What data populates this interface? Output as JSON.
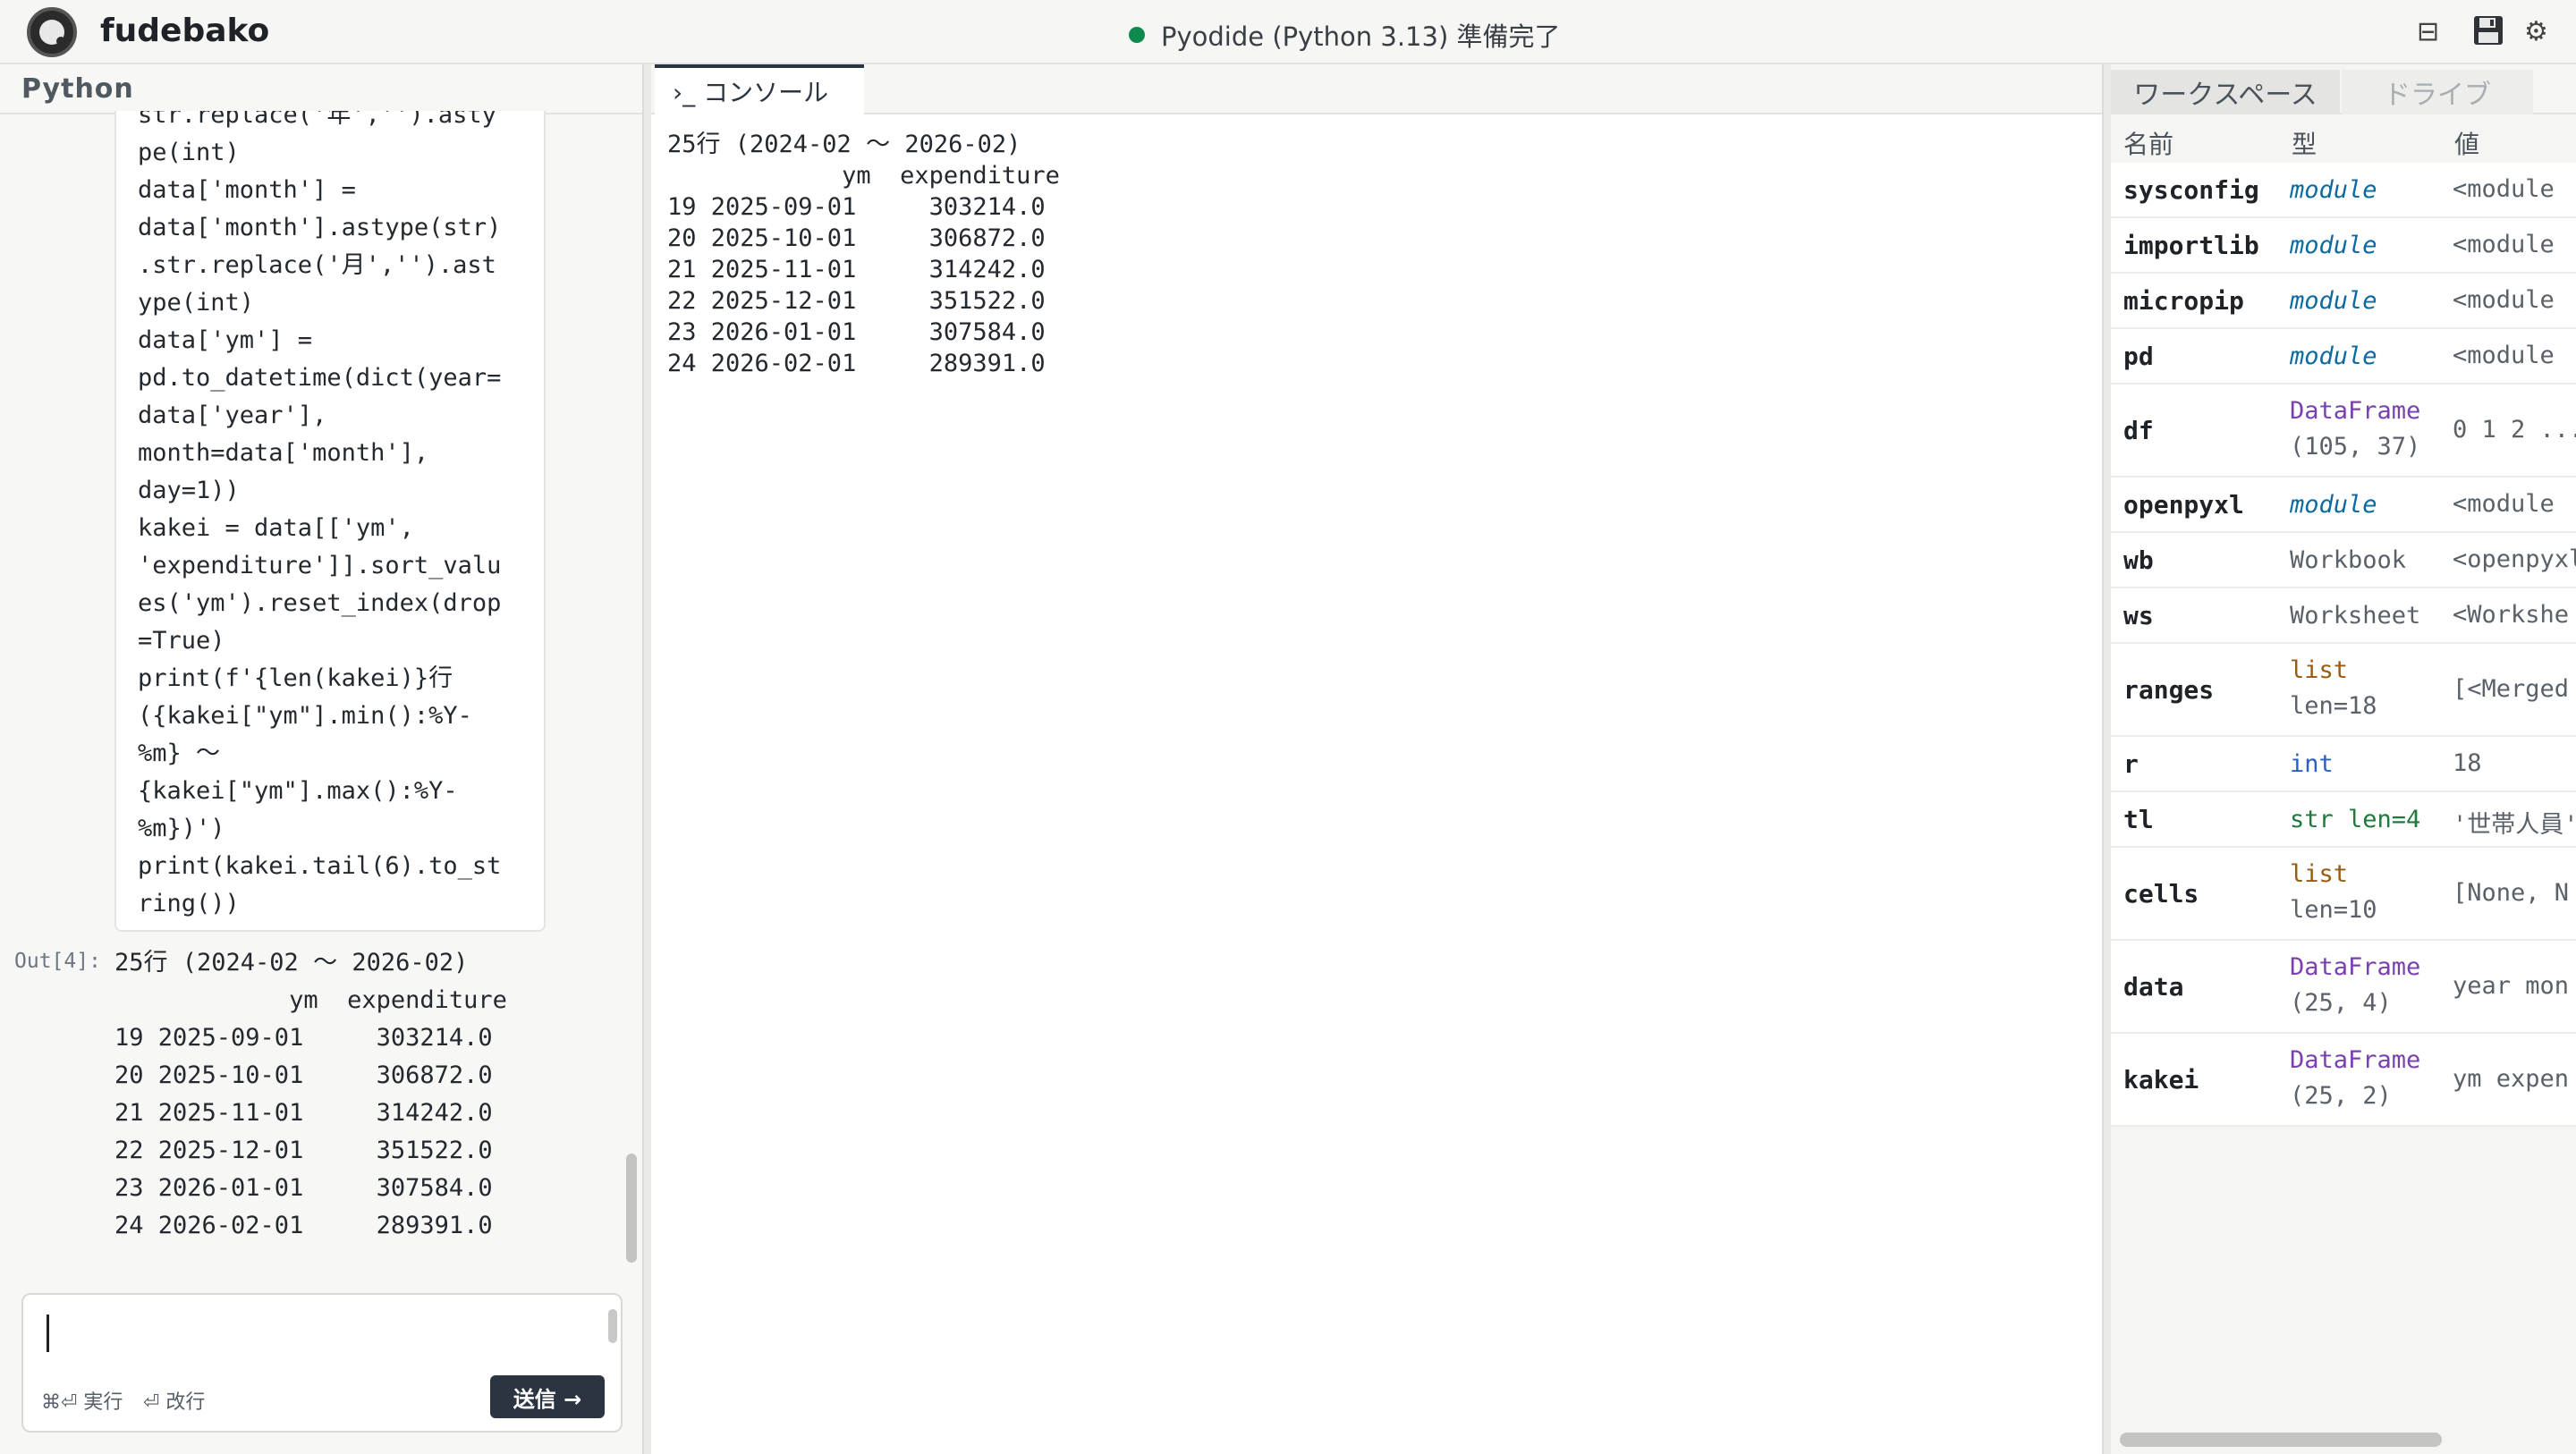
{
  "header": {
    "app_title": "fudebako",
    "status_text": "Pyodide (Python 3.13) 準備完了",
    "status_color": "#0e8a4f",
    "icons": [
      "split-view-icon",
      "save-icon",
      "settings-icon"
    ]
  },
  "left_panel": {
    "title": "Python",
    "code_lines": [
      "str.replace('年','').asty",
      "pe(int)",
      "data['month'] =",
      "data['month'].astype(str)",
      ".str.replace('月','').ast",
      "ype(int)",
      "data['ym'] =",
      "pd.to_datetime(dict(year=",
      "data['year'],",
      "month=data['month'],",
      "day=1))",
      "kakei = data[['ym',",
      "'expenditure']].sort_valu",
      "es('ym').reset_index(drop",
      "=True)",
      "print(f'{len(kakei)}行",
      "({kakei[\"ym\"].min():%Y-",
      "%m} 〜",
      "{kakei[\"ym\"].max():%Y-",
      "%m})')",
      "print(kakei.tail(6).to_st",
      "ring())"
    ],
    "output_label": "Out[4]:",
    "output_lines": [
      "25行 (2024-02 〜 2026-02)",
      "            ym  expenditure",
      "19 2025-09-01     303214.0",
      "20 2025-10-01     306872.0",
      "21 2025-11-01     314242.0",
      "22 2025-12-01     351522.0",
      "23 2026-01-01     307584.0",
      "24 2026-02-01     289391.0"
    ],
    "input": {
      "value": "",
      "placeholder": ""
    },
    "hint_run": "⌘⏎ 実行",
    "hint_newline": "⏎ 改行",
    "send_label": "送信 →"
  },
  "console": {
    "tab_label": "›_ コンソール",
    "lines": [
      "25行 (2024-02 〜 2026-02)",
      "            ym  expenditure",
      "19 2025-09-01     303214.0",
      "20 2025-10-01     306872.0",
      "21 2025-11-01     314242.0",
      "22 2025-12-01     351522.0",
      "23 2026-01-01     307584.0",
      "24 2026-02-01     289391.0"
    ]
  },
  "workspace": {
    "tabs": [
      "ワークスペース",
      "ドライブ"
    ],
    "columns": [
      "名前",
      "型",
      "値"
    ],
    "type_colors": {
      "module": "#0b6aa2",
      "DataFrame": "#7a3fb0",
      "Workbook": "#5a6168",
      "Worksheet": "#5a6168",
      "list": "#9a5a10",
      "int": "#2b5fc4",
      "str": "#1e7a3a"
    },
    "variables": [
      {
        "name": "sysconfig",
        "type": "module",
        "type_lines": [
          "module"
        ],
        "italic": true,
        "value": "<module"
      },
      {
        "name": "importlib",
        "type": "module",
        "type_lines": [
          "module"
        ],
        "italic": true,
        "value": "<module"
      },
      {
        "name": "micropip",
        "type": "module",
        "type_lines": [
          "module"
        ],
        "italic": true,
        "value": "<module"
      },
      {
        "name": "pd",
        "type": "module",
        "type_lines": [
          "module"
        ],
        "italic": true,
        "value": "<module"
      },
      {
        "name": "df",
        "type": "DataFrame",
        "type_lines": [
          "DataFrame",
          "(105, 37)"
        ],
        "italic": false,
        "value": "0 1 2 ..."
      },
      {
        "name": "openpyxl",
        "type": "module",
        "type_lines": [
          "module"
        ],
        "italic": true,
        "value": "<module"
      },
      {
        "name": "wb",
        "type": "Workbook",
        "type_lines": [
          "Workbook"
        ],
        "italic": false,
        "value": "<openpyxl"
      },
      {
        "name": "ws",
        "type": "Worksheet",
        "type_lines": [
          "Worksheet"
        ],
        "italic": false,
        "value": "<Workshe"
      },
      {
        "name": "ranges",
        "type": "list",
        "type_lines": [
          "list",
          "len=18"
        ],
        "italic": false,
        "value": "[<Merged"
      },
      {
        "name": "r",
        "type": "int",
        "type_lines": [
          "int"
        ],
        "italic": false,
        "value": "18"
      },
      {
        "name": "tl",
        "type": "str",
        "type_lines": [
          "str len=4"
        ],
        "italic": false,
        "value": "'世帯人員'"
      },
      {
        "name": "cells",
        "type": "list",
        "type_lines": [
          "list",
          "len=10"
        ],
        "italic": false,
        "value": "[None, N"
      },
      {
        "name": "data",
        "type": "DataFrame",
        "type_lines": [
          "DataFrame",
          "(25, 4)"
        ],
        "italic": false,
        "value": "year mon"
      },
      {
        "name": "kakei",
        "type": "DataFrame",
        "type_lines": [
          "DataFrame",
          "(25, 2)"
        ],
        "italic": false,
        "value": "ym expen"
      }
    ]
  }
}
